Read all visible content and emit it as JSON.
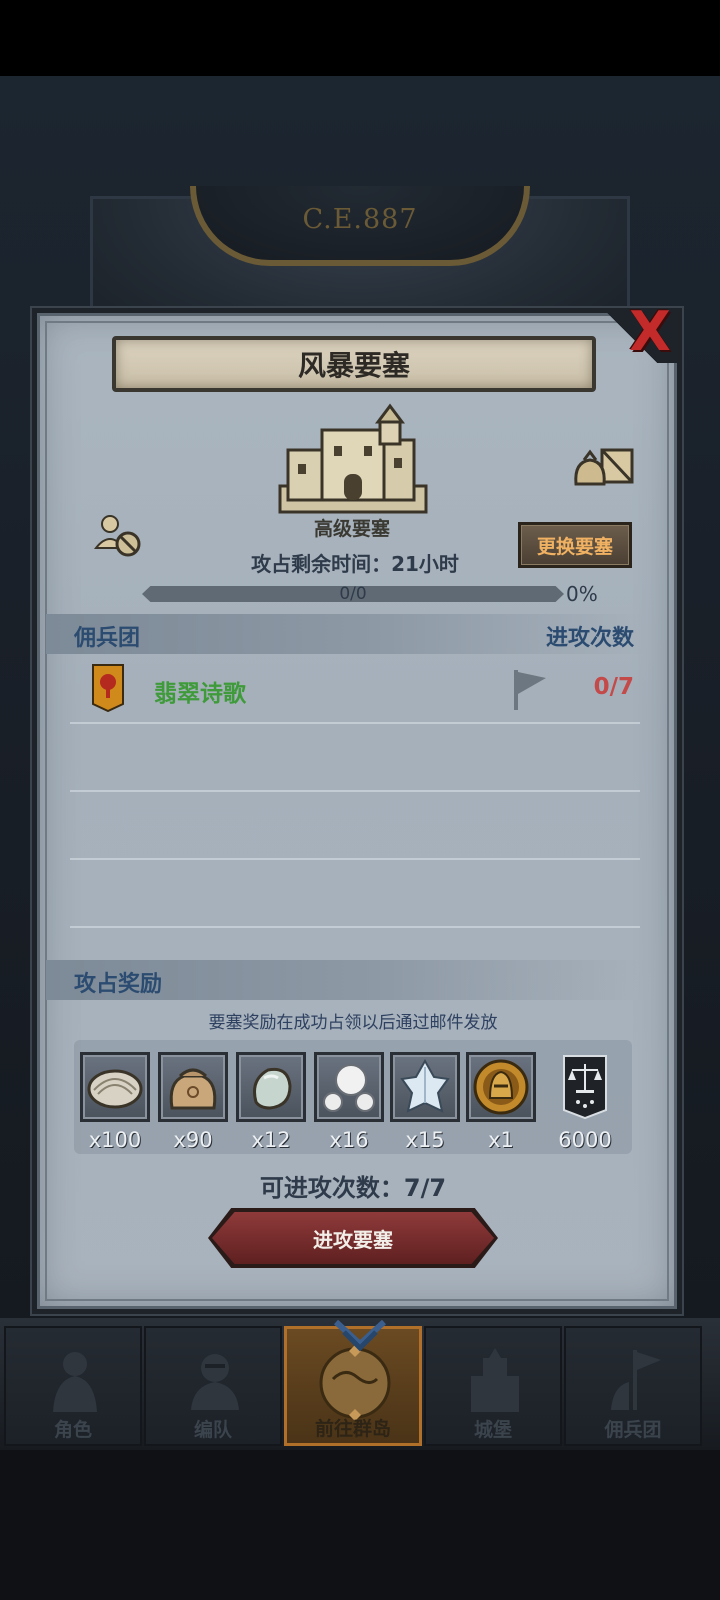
{
  "era": {
    "label": "C.E.887"
  },
  "dialog": {
    "title": "风暴要塞",
    "close_symbol": "X",
    "castle_name": "高级要塞",
    "remaining_time": "攻占剩余时间：21小时",
    "change_button": "更换要塞",
    "progress": {
      "text": "0/0",
      "percent_label": "0%",
      "fraction": 0
    }
  },
  "mercenaries": {
    "header_left": "佣兵团",
    "header_right": "进攻次数",
    "rows": [
      {
        "name": "翡翠诗歌",
        "count": "0/7",
        "banner_color": "#d08a1c"
      }
    ]
  },
  "rewards": {
    "header": "攻占奖励",
    "note": "要塞奖励在成功占领以后通过邮件发放",
    "items": [
      {
        "icon": "oyster-icon",
        "qty": "x100"
      },
      {
        "icon": "sack-icon",
        "qty": "x90"
      },
      {
        "icon": "jade-stone-icon",
        "qty": "x12"
      },
      {
        "icon": "pearls-icon",
        "qty": "x16"
      },
      {
        "icon": "crystal-icon",
        "qty": "x15"
      },
      {
        "icon": "knight-medal-icon",
        "qty": "x1"
      },
      {
        "icon": "scales-banner-icon",
        "qty": "6000"
      }
    ]
  },
  "attack": {
    "count_label": "可进攻次数：7/7",
    "button": "进攻要塞"
  },
  "nav": {
    "tabs": [
      {
        "label": "角色",
        "icon": "knight-icon"
      },
      {
        "label": "编队",
        "icon": "armor-icon"
      },
      {
        "label": "前往群岛",
        "icon": "islands-icon"
      },
      {
        "label": "城堡",
        "icon": "castle-icon"
      },
      {
        "label": "佣兵团",
        "icon": "mercenary-icon"
      }
    ]
  },
  "colors": {
    "accent_gold": "#c79b3a",
    "merc_green": "#3f9b3a",
    "count_red": "#c44a4a",
    "header_blue": "#2b4b70"
  }
}
